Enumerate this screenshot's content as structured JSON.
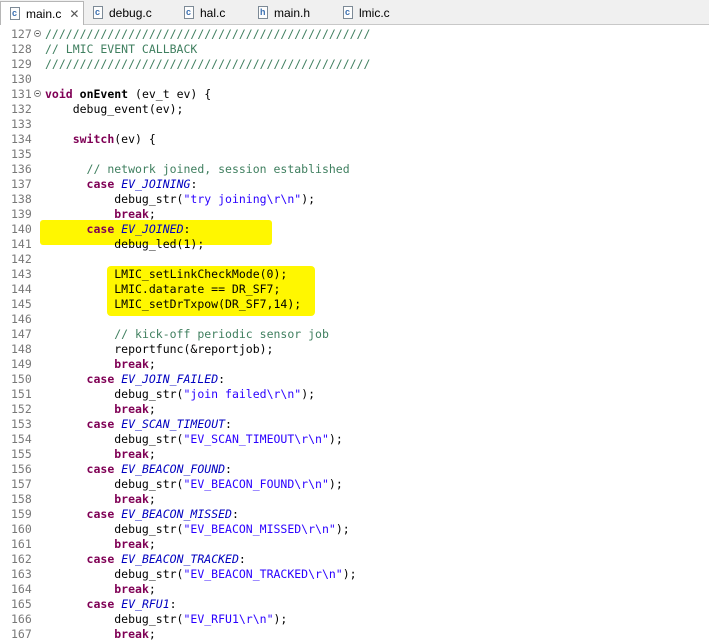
{
  "tabs": [
    {
      "label": "main.c",
      "active": true,
      "closable": true
    },
    {
      "label": "debug.c",
      "active": false
    },
    {
      "label": "hal.c",
      "active": false
    },
    {
      "label": "main.h",
      "active": false
    },
    {
      "label": "lmic.c",
      "active": false
    }
  ],
  "highlight_color": "#fff700",
  "editor": {
    "lines": [
      {
        "num": "127",
        "fold": true,
        "tokens": [
          {
            "t": "///////////////////////////////////////////////",
            "c": "cm"
          }
        ]
      },
      {
        "num": "128",
        "tokens": [
          {
            "t": "// LMIC EVENT CALLBACK",
            "c": "cm"
          }
        ]
      },
      {
        "num": "129",
        "tokens": [
          {
            "t": "///////////////////////////////////////////////",
            "c": "cm"
          }
        ]
      },
      {
        "num": "130",
        "tokens": []
      },
      {
        "num": "131",
        "fold": true,
        "tokens": [
          {
            "t": "void",
            "c": "kw"
          },
          {
            "t": " "
          },
          {
            "t": "onEvent",
            "c": "fn"
          },
          {
            "t": " (ev_t ev) {"
          }
        ]
      },
      {
        "num": "132",
        "tokens": [
          {
            "t": "    debug_event(ev);"
          }
        ]
      },
      {
        "num": "133",
        "tokens": []
      },
      {
        "num": "134",
        "tokens": [
          {
            "t": "    "
          },
          {
            "t": "switch",
            "c": "kw"
          },
          {
            "t": "(ev) {"
          }
        ]
      },
      {
        "num": "135",
        "tokens": []
      },
      {
        "num": "136",
        "tokens": [
          {
            "t": "      "
          },
          {
            "t": "// network joined, session established",
            "c": "cm"
          }
        ]
      },
      {
        "num": "137",
        "tokens": [
          {
            "t": "      "
          },
          {
            "t": "case",
            "c": "kw"
          },
          {
            "t": " "
          },
          {
            "t": "EV_JOINING",
            "c": "en"
          },
          {
            "t": ":"
          }
        ]
      },
      {
        "num": "138",
        "tokens": [
          {
            "t": "          debug_str("
          },
          {
            "t": "\"try joining\\r\\n\"",
            "c": "st"
          },
          {
            "t": ");"
          }
        ]
      },
      {
        "num": "139",
        "tokens": [
          {
            "t": "          "
          },
          {
            "t": "break",
            "c": "kw"
          },
          {
            "t": ";"
          }
        ]
      },
      {
        "num": "140",
        "tokens": [
          {
            "t": "      "
          },
          {
            "t": "case",
            "c": "kw"
          },
          {
            "t": " "
          },
          {
            "t": "EV_JOINED",
            "c": "en"
          },
          {
            "t": ":"
          }
        ]
      },
      {
        "num": "141",
        "tokens": [
          {
            "t": "          debug_led(1);"
          }
        ]
      },
      {
        "num": "142",
        "tokens": []
      },
      {
        "num": "143",
        "tokens": [
          {
            "t": "          LMIC_setLinkCheckMode(0);"
          }
        ]
      },
      {
        "num": "144",
        "tokens": [
          {
            "t": "          LMIC.datarate == DR_SF7;"
          }
        ]
      },
      {
        "num": "145",
        "tokens": [
          {
            "t": "          LMIC_setDrTxpow(DR_SF7,14);"
          }
        ]
      },
      {
        "num": "146",
        "tokens": []
      },
      {
        "num": "147",
        "tokens": [
          {
            "t": "          "
          },
          {
            "t": "// kick-off periodic sensor job",
            "c": "cm"
          }
        ]
      },
      {
        "num": "148",
        "tokens": [
          {
            "t": "          reportfunc(&reportjob);"
          }
        ]
      },
      {
        "num": "149",
        "tokens": [
          {
            "t": "          "
          },
          {
            "t": "break",
            "c": "kw"
          },
          {
            "t": ";"
          }
        ]
      },
      {
        "num": "150",
        "tokens": [
          {
            "t": "      "
          },
          {
            "t": "case",
            "c": "kw"
          },
          {
            "t": " "
          },
          {
            "t": "EV_JOIN_FAILED",
            "c": "en"
          },
          {
            "t": ":"
          }
        ]
      },
      {
        "num": "151",
        "tokens": [
          {
            "t": "          debug_str("
          },
          {
            "t": "\"join failed\\r\\n\"",
            "c": "st"
          },
          {
            "t": ");"
          }
        ]
      },
      {
        "num": "152",
        "tokens": [
          {
            "t": "          "
          },
          {
            "t": "break",
            "c": "kw"
          },
          {
            "t": ";"
          }
        ]
      },
      {
        "num": "153",
        "tokens": [
          {
            "t": "      "
          },
          {
            "t": "case",
            "c": "kw"
          },
          {
            "t": " "
          },
          {
            "t": "EV_SCAN_TIMEOUT",
            "c": "en"
          },
          {
            "t": ":"
          }
        ]
      },
      {
        "num": "154",
        "tokens": [
          {
            "t": "          debug_str("
          },
          {
            "t": "\"EV_SCAN_TIMEOUT\\r\\n\"",
            "c": "st"
          },
          {
            "t": ");"
          }
        ]
      },
      {
        "num": "155",
        "tokens": [
          {
            "t": "          "
          },
          {
            "t": "break",
            "c": "kw"
          },
          {
            "t": ";"
          }
        ]
      },
      {
        "num": "156",
        "tokens": [
          {
            "t": "      "
          },
          {
            "t": "case",
            "c": "kw"
          },
          {
            "t": " "
          },
          {
            "t": "EV_BEACON_FOUND",
            "c": "en"
          },
          {
            "t": ":"
          }
        ]
      },
      {
        "num": "157",
        "tokens": [
          {
            "t": "          debug_str("
          },
          {
            "t": "\"EV_BEACON_FOUND\\r\\n\"",
            "c": "st"
          },
          {
            "t": ");"
          }
        ]
      },
      {
        "num": "158",
        "tokens": [
          {
            "t": "          "
          },
          {
            "t": "break",
            "c": "kw"
          },
          {
            "t": ";"
          }
        ]
      },
      {
        "num": "159",
        "tokens": [
          {
            "t": "      "
          },
          {
            "t": "case",
            "c": "kw"
          },
          {
            "t": " "
          },
          {
            "t": "EV_BEACON_MISSED",
            "c": "en"
          },
          {
            "t": ":"
          }
        ]
      },
      {
        "num": "160",
        "tokens": [
          {
            "t": "          debug_str("
          },
          {
            "t": "\"EV_BEACON_MISSED\\r\\n\"",
            "c": "st"
          },
          {
            "t": ");"
          }
        ]
      },
      {
        "num": "161",
        "tokens": [
          {
            "t": "          "
          },
          {
            "t": "break",
            "c": "kw"
          },
          {
            "t": ";"
          }
        ]
      },
      {
        "num": "162",
        "tokens": [
          {
            "t": "      "
          },
          {
            "t": "case",
            "c": "kw"
          },
          {
            "t": " "
          },
          {
            "t": "EV_BEACON_TRACKED",
            "c": "en"
          },
          {
            "t": ":"
          }
        ]
      },
      {
        "num": "163",
        "tokens": [
          {
            "t": "          debug_str("
          },
          {
            "t": "\"EV_BEACON_TRACKED\\r\\n\"",
            "c": "st"
          },
          {
            "t": ");"
          }
        ]
      },
      {
        "num": "164",
        "tokens": [
          {
            "t": "          "
          },
          {
            "t": "break",
            "c": "kw"
          },
          {
            "t": ";"
          }
        ]
      },
      {
        "num": "165",
        "tokens": [
          {
            "t": "      "
          },
          {
            "t": "case",
            "c": "kw"
          },
          {
            "t": " "
          },
          {
            "t": "EV_RFU1",
            "c": "en"
          },
          {
            "t": ":"
          }
        ]
      },
      {
        "num": "166",
        "tokens": [
          {
            "t": "          debug_str("
          },
          {
            "t": "\"EV_RFU1\\r\\n\"",
            "c": "st"
          },
          {
            "t": ");"
          }
        ]
      },
      {
        "num": "167",
        "tokens": [
          {
            "t": "          "
          },
          {
            "t": "break",
            "c": "kw"
          },
          {
            "t": ";"
          }
        ]
      }
    ]
  }
}
